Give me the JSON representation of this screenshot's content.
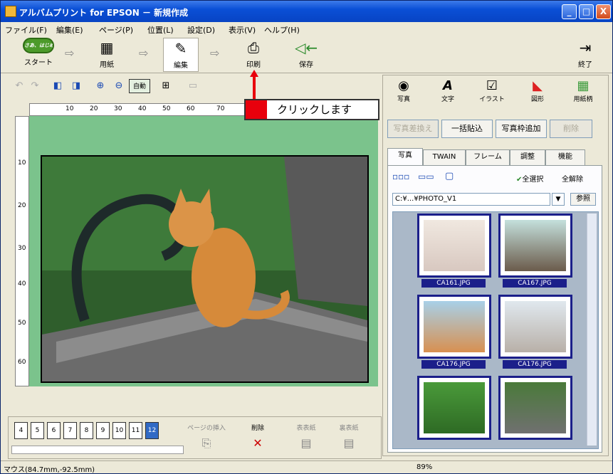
{
  "window": {
    "title": "アルバムプリント for EPSON － 新規作成"
  },
  "titlebar_buttons": [
    "_",
    "□",
    "X"
  ],
  "menu": [
    "ファイル(F)",
    "編集(E)",
    "ページ(P)",
    "位置(L)",
    "設定(D)",
    "表示(V)",
    "ヘルプ(H)"
  ],
  "main_toolbar": {
    "start_logo": "さあ、はじめよう",
    "start_label": "スタート",
    "paper_label": "用紙",
    "edit_label": "編集",
    "print_label": "印刷",
    "save_label": "保存",
    "exit_label": "終了"
  },
  "sec_toolbar": {
    "auto_label": "自動"
  },
  "ruler": {
    "h_ticks": [
      "10",
      "20",
      "30",
      "40",
      "50",
      "60",
      "70"
    ],
    "v_ticks": [
      "10",
      "20",
      "30",
      "40",
      "50",
      "60"
    ]
  },
  "callout": {
    "text": "クリックします"
  },
  "right_tools": [
    {
      "label": "写真",
      "icon": "photo-icon"
    },
    {
      "label": "文字",
      "icon": "text-icon"
    },
    {
      "label": "イラスト",
      "icon": "illustration-icon"
    },
    {
      "label": "図形",
      "icon": "shape-icon"
    },
    {
      "label": "用紙柄",
      "icon": "paper-pattern-icon"
    }
  ],
  "actions": {
    "replace": "写真差換え",
    "paste_all": "一括貼込",
    "add_frame": "写真枠追加",
    "delete": "削除"
  },
  "tabs": [
    "写真",
    "TWAIN",
    "フレーム",
    "調整",
    "機能"
  ],
  "photo_panel": {
    "select_all": "全選択",
    "deselect_all": "全解除",
    "path": "C:¥...¥PHOTO_V1",
    "browse": "参照",
    "thumbnails": [
      "CA161.JPG",
      "CA167.JPG",
      "CA176.JPG",
      "CA176.JPG",
      "",
      ""
    ]
  },
  "pages": [
    "4",
    "5",
    "6",
    "7",
    "8",
    "9",
    "10",
    "11",
    "12"
  ],
  "page_actions": {
    "insert": "ページの挿入",
    "delete": "削除",
    "front": "表表紙",
    "back": "裏表紙"
  },
  "status": {
    "mouse": "マウス(84.7mm,-92.5mm)",
    "zoom": "89%"
  },
  "colors": {
    "accent_red": "#e8000c",
    "canvas_green": "#7bc38c",
    "selection_blue": "#1b1f8a"
  }
}
